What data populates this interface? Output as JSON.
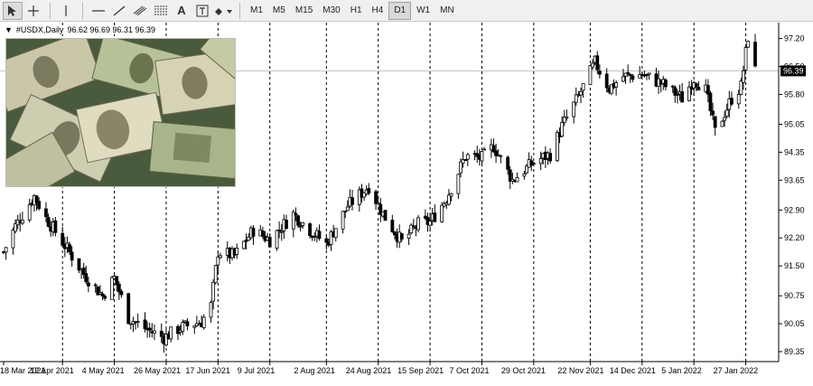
{
  "toolbar": {
    "tools": [
      "cursor-icon",
      "crosshair-icon",
      "vertical-line-icon",
      "horizontal-line-icon",
      "trendline-icon",
      "channel-icon",
      "fibonacci-icon",
      "text-icon",
      "text-label-icon",
      "shapes-icon"
    ],
    "text_tool_label": "A",
    "timeframes": [
      "M1",
      "M5",
      "M15",
      "M30",
      "H1",
      "H4",
      "D1",
      "W1",
      "MN"
    ],
    "active_timeframe": "D1"
  },
  "header": {
    "symbol": "#USDX,Daily",
    "ohlc": "96.62 96.69 96.31 96.39"
  },
  "colors": {
    "candle": "#000000",
    "grid_dashed": "#000000",
    "current_price_line": "#c0c0c0",
    "axis": "#000000",
    "background": "#ffffff"
  },
  "chart_data": {
    "type": "candlestick",
    "title": "#USDX,Daily",
    "y_ticks": [
      97.2,
      96.5,
      95.8,
      95.05,
      94.35,
      93.65,
      92.9,
      92.2,
      91.5,
      90.75,
      90.05,
      89.35
    ],
    "ylim": [
      89.1,
      97.6
    ],
    "current_price": "96.39",
    "x_ticks": [
      "18 Mar 2021",
      "12 Apr 2021",
      "4 May 2021",
      "26 May 2021",
      "17 Jun 2021",
      "9 Jul 2021",
      "2 Aug 2021",
      "24 Aug 2021",
      "15 Sep 2021",
      "7 Oct 2021",
      "29 Oct 2021",
      "22 Nov 2021",
      "14 Dec 2021",
      "5 Jan 2022",
      "27 Jan 2022"
    ],
    "close_path": [
      {
        "date": "2021-03-18",
        "close": 91.85
      },
      {
        "date": "2021-03-23",
        "close": 92.5
      },
      {
        "date": "2021-03-31",
        "close": 93.25
      },
      {
        "date": "2021-04-05",
        "close": 92.7
      },
      {
        "date": "2021-04-12",
        "close": 92.1
      },
      {
        "date": "2021-04-21",
        "close": 91.3
      },
      {
        "date": "2021-04-29",
        "close": 90.75
      },
      {
        "date": "2021-05-04",
        "close": 91.2
      },
      {
        "date": "2021-05-10",
        "close": 90.2
      },
      {
        "date": "2021-05-18",
        "close": 89.9
      },
      {
        "date": "2021-05-25",
        "close": 89.7
      },
      {
        "date": "2021-06-01",
        "close": 89.95
      },
      {
        "date": "2021-06-10",
        "close": 90.1
      },
      {
        "date": "2021-06-14",
        "close": 90.5
      },
      {
        "date": "2021-06-17",
        "close": 91.85
      },
      {
        "date": "2021-06-24",
        "close": 91.75
      },
      {
        "date": "2021-07-02",
        "close": 92.4
      },
      {
        "date": "2021-07-09",
        "close": 92.15
      },
      {
        "date": "2021-07-19",
        "close": 92.8
      },
      {
        "date": "2021-07-27",
        "close": 92.35
      },
      {
        "date": "2021-08-02",
        "close": 92.05
      },
      {
        "date": "2021-08-11",
        "close": 93.0
      },
      {
        "date": "2021-08-20",
        "close": 93.5
      },
      {
        "date": "2021-08-26",
        "close": 92.8
      },
      {
        "date": "2021-09-03",
        "close": 92.1
      },
      {
        "date": "2021-09-10",
        "close": 92.55
      },
      {
        "date": "2021-09-15",
        "close": 92.6
      },
      {
        "date": "2021-09-22",
        "close": 93.2
      },
      {
        "date": "2021-09-30",
        "close": 94.25
      },
      {
        "date": "2021-10-07",
        "close": 94.2
      },
      {
        "date": "2021-10-12",
        "close": 94.5
      },
      {
        "date": "2021-10-20",
        "close": 93.65
      },
      {
        "date": "2021-10-25",
        "close": 93.9
      },
      {
        "date": "2021-10-29",
        "close": 94.1
      },
      {
        "date": "2021-11-05",
        "close": 94.3
      },
      {
        "date": "2021-11-10",
        "close": 95.0
      },
      {
        "date": "2021-11-17",
        "close": 95.75
      },
      {
        "date": "2021-11-24",
        "close": 96.6
      },
      {
        "date": "2021-11-30",
        "close": 95.95
      },
      {
        "date": "2021-12-06",
        "close": 96.25
      },
      {
        "date": "2021-12-14",
        "close": 96.3
      },
      {
        "date": "2021-12-23",
        "close": 96.05
      },
      {
        "date": "2021-12-31",
        "close": 95.7
      },
      {
        "date": "2022-01-05",
        "close": 96.2
      },
      {
        "date": "2022-01-10",
        "close": 95.9
      },
      {
        "date": "2022-01-14",
        "close": 94.85
      },
      {
        "date": "2022-01-21",
        "close": 95.7
      },
      {
        "date": "2022-01-25",
        "close": 96.0
      },
      {
        "date": "2022-01-28",
        "close": 97.25
      },
      {
        "date": "2022-01-31",
        "close": 96.4
      }
    ]
  }
}
